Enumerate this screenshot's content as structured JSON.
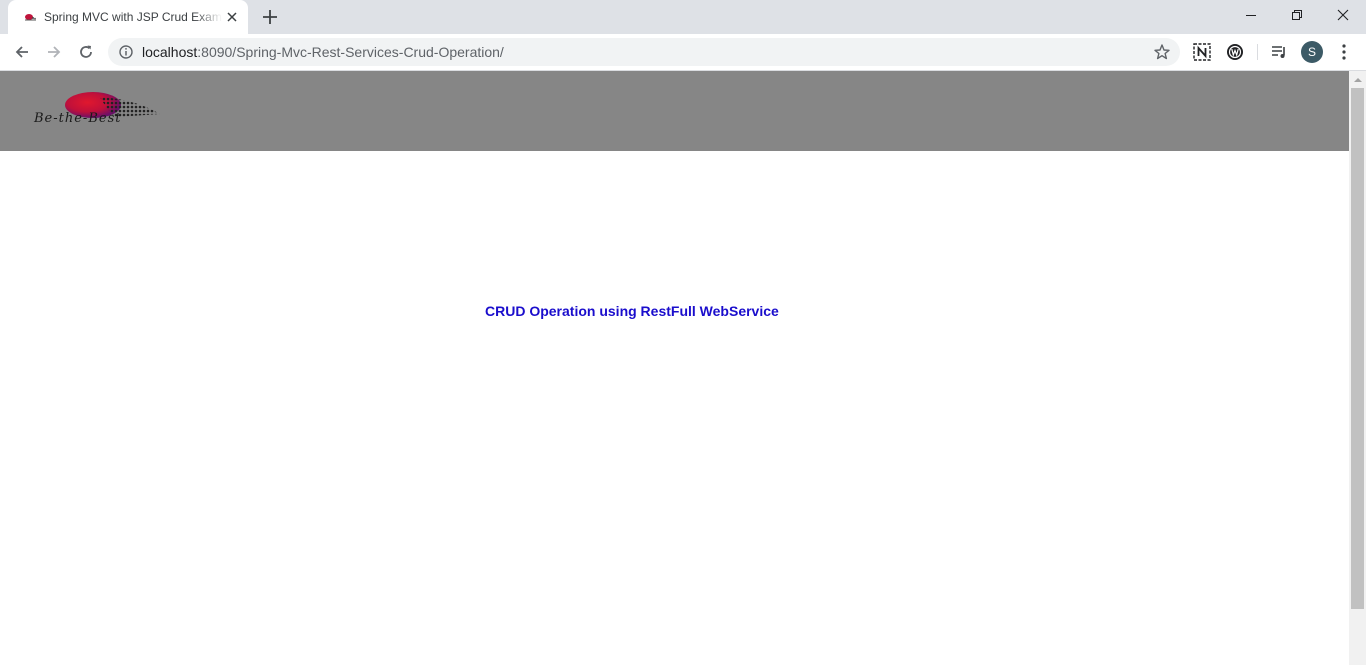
{
  "browser": {
    "tab": {
      "title": "Spring MVC with JSP Crud Example",
      "favicon": "be-the-best-favicon",
      "close_icon": "close-icon"
    },
    "new_tab_icon": "plus-icon",
    "window_controls": {
      "minimize_icon": "minimize-icon",
      "maximize_icon": "restore-icon",
      "close_icon": "close-icon"
    },
    "toolbar": {
      "back_icon": "back-arrow-icon",
      "forward_icon": "forward-arrow-icon",
      "reload_icon": "reload-icon"
    },
    "omnibox": {
      "host": "localhost",
      "path": ":8090/Spring-Mvc-Rest-Services-Crud-Operation/",
      "info_icon": "info-icon",
      "bookmark_icon": "star-icon"
    },
    "extensions": [
      {
        "name": "n-extension-icon"
      },
      {
        "name": "w-extension-icon"
      },
      {
        "name": "media-queue-icon"
      }
    ],
    "profile": {
      "initial": "S",
      "color": "#3c5a66"
    },
    "menu_icon": "kebab-menu-icon"
  },
  "page": {
    "header": {
      "background": "#868686",
      "logo": {
        "text": "Be-the-Best"
      }
    },
    "heading": "CRUD Operation using RestFull WebService",
    "heading_color": "#1a0dcc"
  }
}
